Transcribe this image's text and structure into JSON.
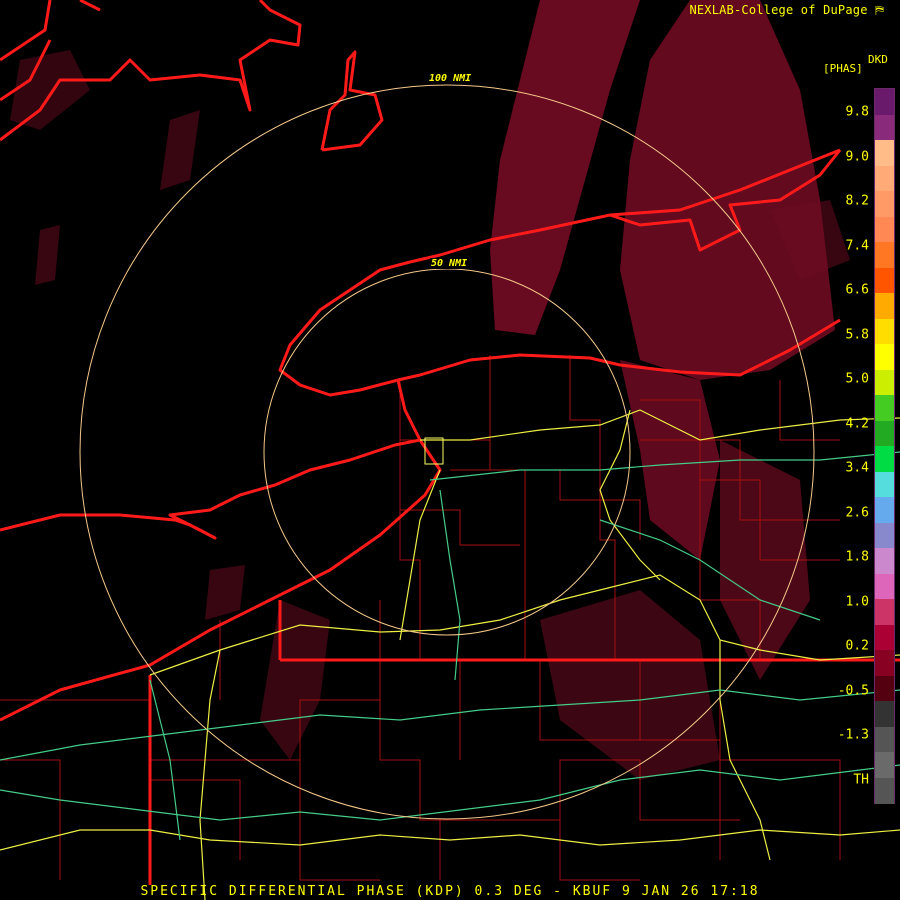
{
  "credit": "NEXLAB-College of DuPage",
  "footer": "SPECIFIC DIFFERENTIAL PHASE (KDP) 0.3 DEG - KBUF 9 JAN 26 17:18",
  "range_rings": [
    "50 NMI",
    "100 NMI"
  ],
  "legend": {
    "title": "DKD",
    "units": "[PHAS]",
    "ticks": [
      "9.8",
      "9.0",
      "8.2",
      "7.4",
      "6.6",
      "5.8",
      "5.0",
      "4.2",
      "3.4",
      "2.6",
      "1.8",
      "1.0",
      "0.2",
      "-0.5",
      "-1.3",
      "TH"
    ],
    "colors": [
      "#6a1a6a",
      "#8a2a7a",
      "#ffbb88",
      "#ffaa77",
      "#ff9966",
      "#ff8855",
      "#ff7722",
      "#ff5500",
      "#ffaa00",
      "#ffdd00",
      "#ffff00",
      "#ccee00",
      "#44cc22",
      "#22aa22",
      "#00dd44",
      "#55dddd",
      "#66aaee",
      "#8888cc",
      "#cc88cc",
      "#dd66bb",
      "#cc3366",
      "#aa0033",
      "#880022",
      "#550011",
      "#333333",
      "#555555",
      "#6a6a6a",
      "#555555"
    ]
  },
  "colors": {
    "coast": "#ff2020",
    "county": "#aa1111",
    "highway_major": "#eeee44",
    "highway_minor": "#44cc88",
    "ring": "#ffcc66",
    "echo": "#7a0d24"
  }
}
